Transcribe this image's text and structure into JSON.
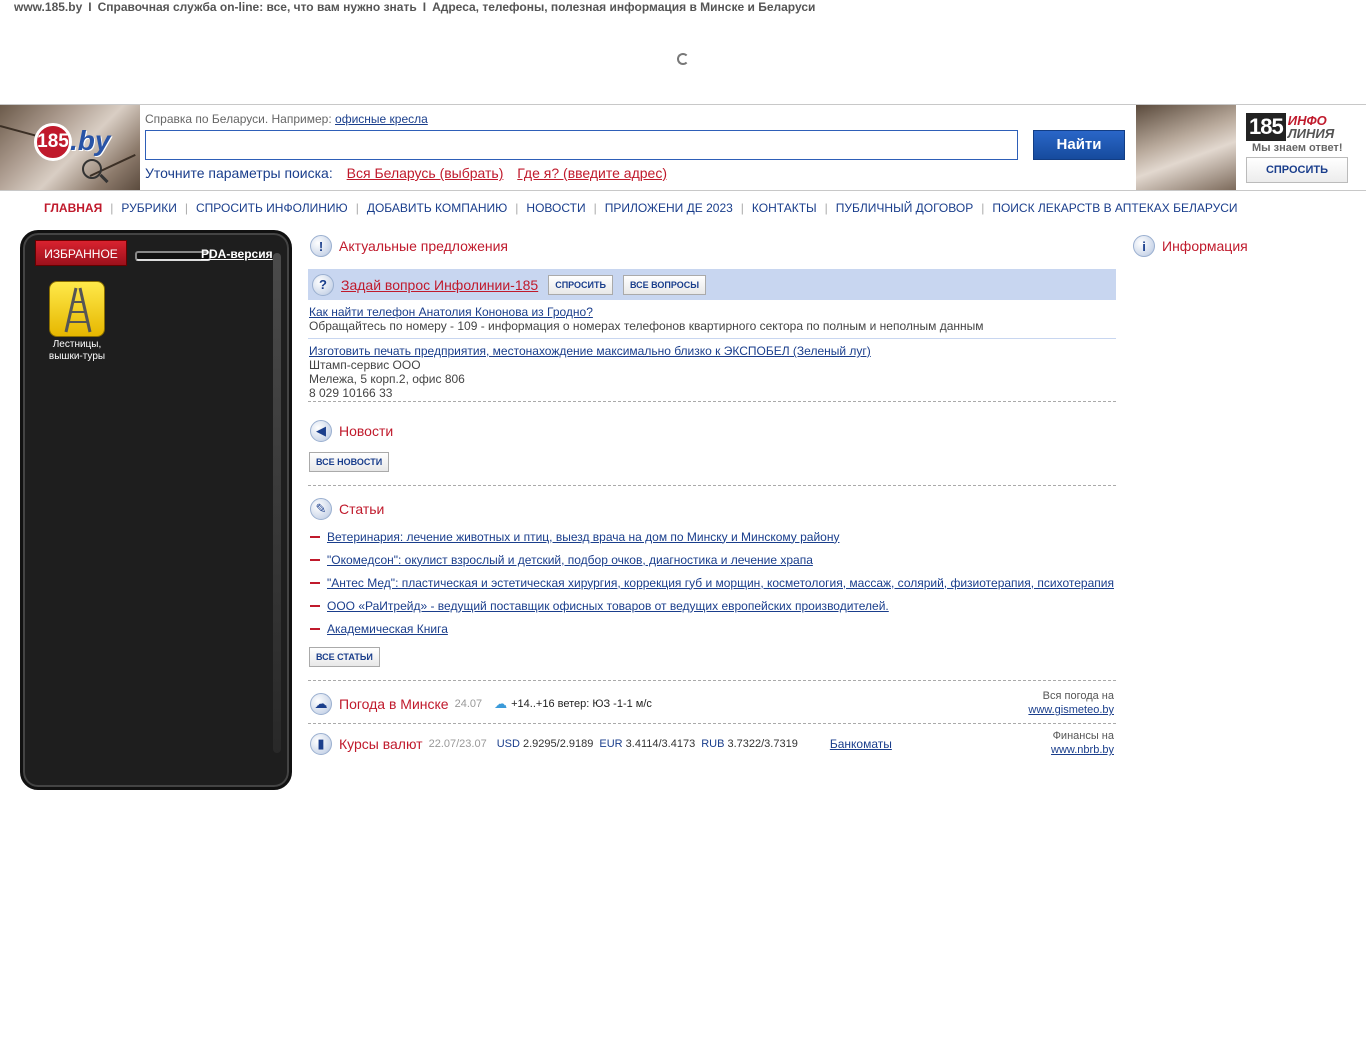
{
  "top_strip": {
    "site": "www.185.by",
    "tagline1": "Справочная служба on-line: все, что вам нужно знать",
    "tagline2": "Адреса, телефоны, полезная информация в Минске и Беларуси",
    "sep": "I"
  },
  "logo": {
    "badge": "185",
    "text": ".by"
  },
  "search": {
    "hint": "Справка по Беларуси. Например:",
    "hint_link": "офисные кресла",
    "value": "",
    "button": "Найти",
    "params_label": "Уточните параметры поиска:",
    "region_link": "Вся Беларусь (выбрать)",
    "where_link": "Где я? (введите адрес)"
  },
  "infoline": {
    "num": "185",
    "word1": "ИНФО",
    "word2": "ЛИНИЯ",
    "slogan": "Мы знаем ответ!",
    "ask": "СПРОСИТЬ"
  },
  "nav": [
    {
      "label": "Главная",
      "active": true
    },
    {
      "label": "Рубрики"
    },
    {
      "label": "Спросить Инфолинию"
    },
    {
      "label": "Добавить компанию"
    },
    {
      "label": "Новости"
    },
    {
      "label": "Приложени де 2023"
    },
    {
      "label": "Контакты"
    },
    {
      "label": "Публичный договор"
    },
    {
      "label": "Поиск лекарств в аптеках Беларуси"
    }
  ],
  "panel": {
    "fav_tab": "ИЗБРАННОЕ",
    "pda": "PDA-версия",
    "tile_label": "Лестницы, вышки-туры"
  },
  "main": {
    "offers_title": "Актуальные предложения",
    "ask_title": "Задай вопрос Инфолинии-185",
    "ask_btn": "Спросить",
    "all_questions": "Все вопросы",
    "qa1": {
      "q": "Как найти телефон Анатолия Кононова из Гродно?",
      "a": "Обращайтесь по номеру - 109 - информация о номерах телефонов квартирного сектора по полным и неполным данным"
    },
    "qa2": {
      "q": "Изготовить печать предприятия, местонахождение максимально близко к ЭКСПОБЕЛ (Зеленый луг)",
      "line1": "Штамп-сервис ООО",
      "line2": "Мележа, 5 корп.2, офис 806",
      "line3": "8 029 10166 33"
    },
    "news_title": "Новости",
    "all_news": "Все новости",
    "articles_title": "Статьи",
    "articles": [
      "Ветеринария: лечение животных и птиц, выезд врача на дом по Минску и Минскому району",
      "\"Окомедсон\": окулист взрослый и детский, подбор очков, диагностика и лечение храпа",
      "\"Антес Мед\": пластическая и эстетическая хирургия, коррекция губ и морщин, косметология, массаж, солярий, физиотерапия, психотерапия",
      "ООО «РаИтрейд» - ведущий поставщик офисных товаров от ведущих европейских производителей.",
      "Академическая Книга"
    ],
    "all_articles": "Все статьи",
    "weather": {
      "title": "Погода в Минске",
      "date": "24.07",
      "text": "+14..+16 ветер: ЮЗ -1-1 м/с",
      "right1": "Вся погода на",
      "right2": "www.gismeteo.by"
    },
    "rates": {
      "title": "Курсы валют",
      "date": "22.07/23.07",
      "usd_label": "USD",
      "usd": "2.9295/2.9189",
      "eur_label": "EUR",
      "eur": "3.4114/3.4173",
      "rub_label": "RUB",
      "rub": "3.7322/3.7319",
      "atm": "Банкоматы",
      "right1": "Финансы на",
      "right2": "www.nbrb.by"
    }
  },
  "info": {
    "title": "Информация"
  }
}
